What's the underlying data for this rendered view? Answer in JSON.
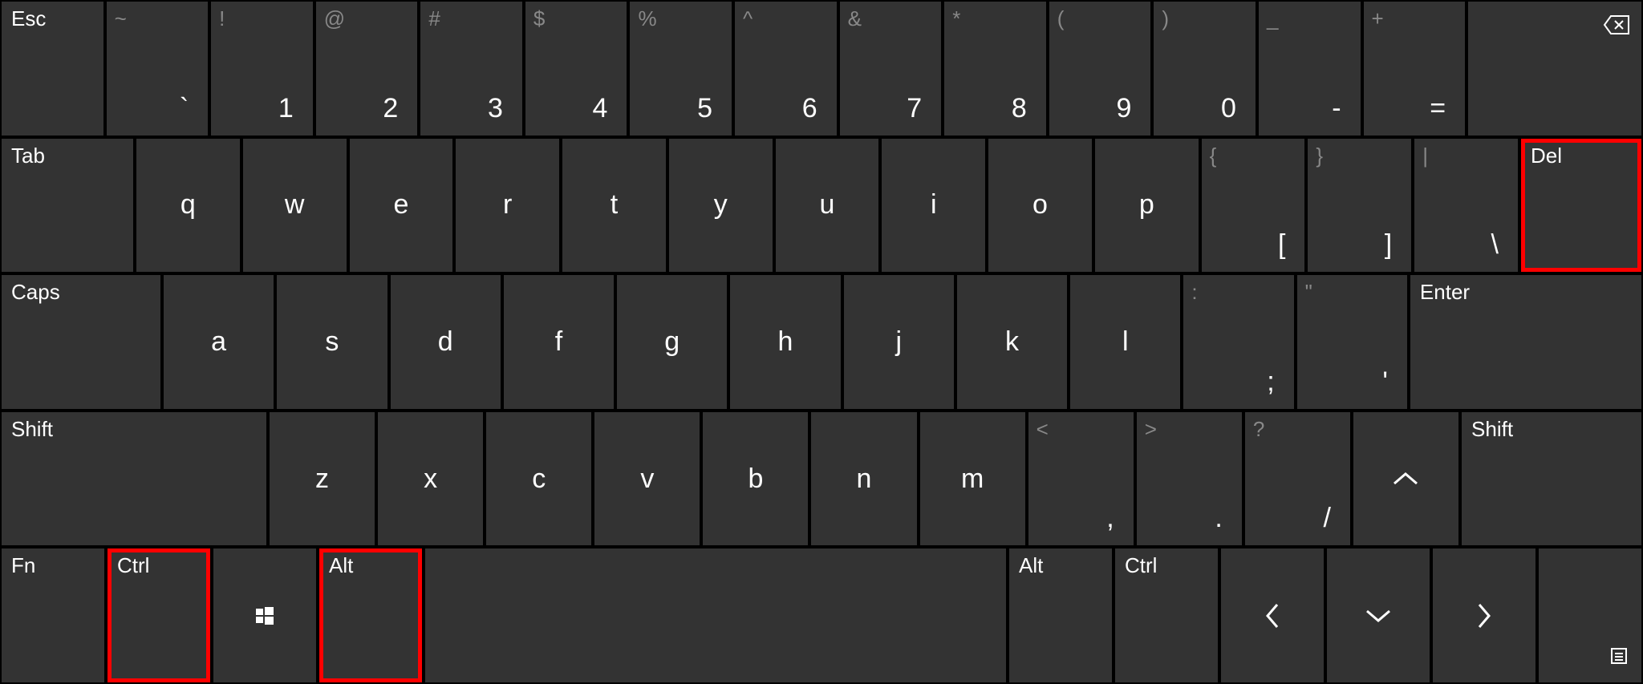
{
  "row1": {
    "esc": "Esc",
    "keys": [
      {
        "shift": "~",
        "main": "`"
      },
      {
        "shift": "!",
        "main": "1"
      },
      {
        "shift": "@",
        "main": "2"
      },
      {
        "shift": "#",
        "main": "3"
      },
      {
        "shift": "$",
        "main": "4"
      },
      {
        "shift": "%",
        "main": "5"
      },
      {
        "shift": "^",
        "main": "6"
      },
      {
        "shift": "&",
        "main": "7"
      },
      {
        "shift": "*",
        "main": "8"
      },
      {
        "shift": "(",
        "main": "9"
      },
      {
        "shift": ")",
        "main": "0"
      },
      {
        "shift": "_",
        "main": "-"
      },
      {
        "shift": "+",
        "main": "="
      }
    ],
    "backspace_icon": "backspace"
  },
  "row2": {
    "tab": "Tab",
    "letters": [
      "q",
      "w",
      "e",
      "r",
      "t",
      "y",
      "u",
      "i",
      "o",
      "p"
    ],
    "brackets": [
      {
        "shift": "{",
        "main": "["
      },
      {
        "shift": "}",
        "main": "]"
      },
      {
        "shift": "|",
        "main": "\\"
      }
    ],
    "del": "Del"
  },
  "row3": {
    "caps": "Caps",
    "letters": [
      "a",
      "s",
      "d",
      "f",
      "g",
      "h",
      "j",
      "k",
      "l"
    ],
    "punct": [
      {
        "shift": ":",
        "main": ";"
      },
      {
        "shift": "\"",
        "main": "'"
      }
    ],
    "enter": "Enter"
  },
  "row4": {
    "shift_l": "Shift",
    "letters": [
      "z",
      "x",
      "c",
      "v",
      "b",
      "n",
      "m"
    ],
    "punct": [
      {
        "shift": "<",
        "main": ","
      },
      {
        "shift": ">",
        "main": "."
      },
      {
        "shift": "?",
        "main": "/"
      }
    ],
    "up_icon": "chevron-up",
    "shift_r": "Shift"
  },
  "row5": {
    "fn": "Fn",
    "ctrl_l": "Ctrl",
    "win_icon": "windows",
    "alt_l": "Alt",
    "space": "",
    "alt_r": "Alt",
    "ctrl_r": "Ctrl",
    "left_icon": "chevron-left",
    "down_icon": "chevron-down",
    "right_icon": "chevron-right",
    "menu_icon": "menu"
  },
  "highlights": [
    "key-del",
    "key-ctrl-left",
    "key-alt-left"
  ]
}
